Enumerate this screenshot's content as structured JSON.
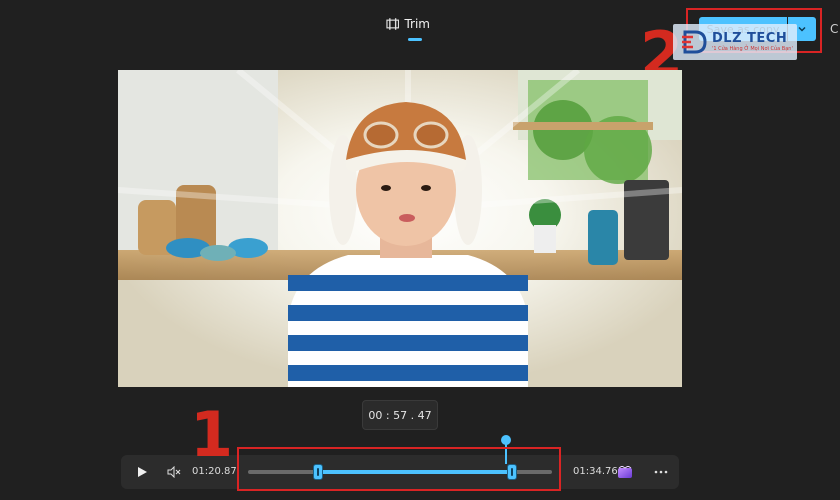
{
  "header": {
    "tab_trim_label": "Trim",
    "save_button_label": "Save as copy",
    "partial_button_label": "C"
  },
  "watermark": {
    "title": "DLZ TECH",
    "subtitle": "'1 Cửa Hàng Ở Mọi Nơi Của Bạn'"
  },
  "annotations": {
    "marker_1": "1",
    "marker_2": "2"
  },
  "player": {
    "current_time": "00 : 57 . 47",
    "trim_start_time": "01:20.87",
    "trim_end_time": "01:34.76",
    "trim_start_fraction": 0.23,
    "trim_end_fraction": 0.87,
    "playhead_fraction": 0.85
  },
  "colors": {
    "accent": "#4cc2ff",
    "annotation_red": "#d92424",
    "background": "#202020"
  },
  "icons": {
    "trim": "trim-icon",
    "split": "chevron-down-icon",
    "play": "play-icon",
    "mute": "mute-icon",
    "clip": "clipchamp-icon",
    "more": "more-icon"
  }
}
